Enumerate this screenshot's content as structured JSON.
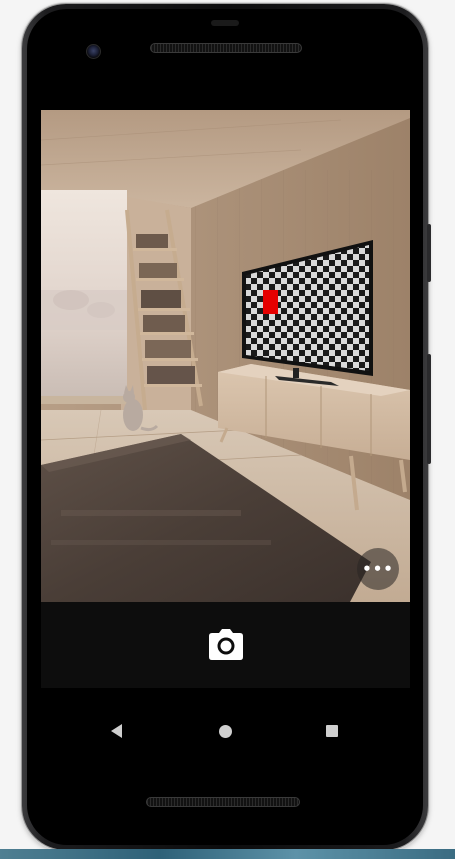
{
  "app": {
    "name": "Camera"
  },
  "viewfinder": {
    "scene": "living-room-with-checkerboard-tv",
    "marker_color": "#e60000"
  },
  "controls": {
    "overflow_label": "•••",
    "shutter_icon": "camera-icon"
  },
  "navigation": {
    "back_icon": "back-triangle-icon",
    "home_icon": "home-circle-icon",
    "recents_icon": "recents-square-icon"
  },
  "colors": {
    "control_bar": "#0d0d0d",
    "icon": "#ffffff",
    "nav_icon": "#cfcfcf"
  }
}
